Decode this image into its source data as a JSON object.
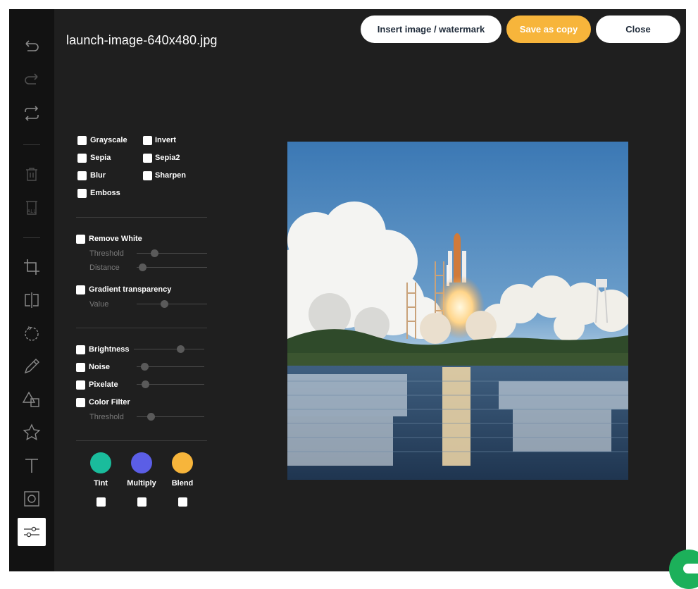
{
  "header": {
    "filename": "launch-image-640x480.jpg",
    "insert_label": "Insert image / watermark",
    "save_label": "Save as copy",
    "close_label": "Close"
  },
  "toolbar": {
    "tools": [
      "undo-icon",
      "redo-icon",
      "reset-icon",
      "delete-icon",
      "delete-all-icon",
      "crop-icon",
      "flip-icon",
      "rotate-icon",
      "draw-icon",
      "shapes-icon",
      "star-icon",
      "text-icon",
      "frame-icon",
      "filters-icon"
    ],
    "delete_all_text": "ALL"
  },
  "filters": {
    "grayscale": "Grayscale",
    "invert": "Invert",
    "sepia": "Sepia",
    "sepia2": "Sepia2",
    "blur": "Blur",
    "sharpen": "Sharpen",
    "emboss": "Emboss"
  },
  "remove_white": {
    "label": "Remove White",
    "threshold_label": "Threshold",
    "distance_label": "Distance"
  },
  "gradient": {
    "label": "Gradient transparency",
    "value_label": "Value"
  },
  "adjustments": {
    "brightness": "Brightness",
    "noise": "Noise",
    "pixelate": "Pixelate",
    "color_filter": "Color Filter",
    "threshold_label": "Threshold"
  },
  "blend": {
    "tint": {
      "label": "Tint",
      "color": "#1abc9c"
    },
    "multiply": {
      "label": "Multiply",
      "color": "#5b5ee6"
    },
    "blend": {
      "label": "Blend",
      "color": "#f7b53b"
    }
  },
  "colors": {
    "accent": "#f7b53b",
    "background": "#1f1f1f",
    "sidebar": "#121212"
  }
}
